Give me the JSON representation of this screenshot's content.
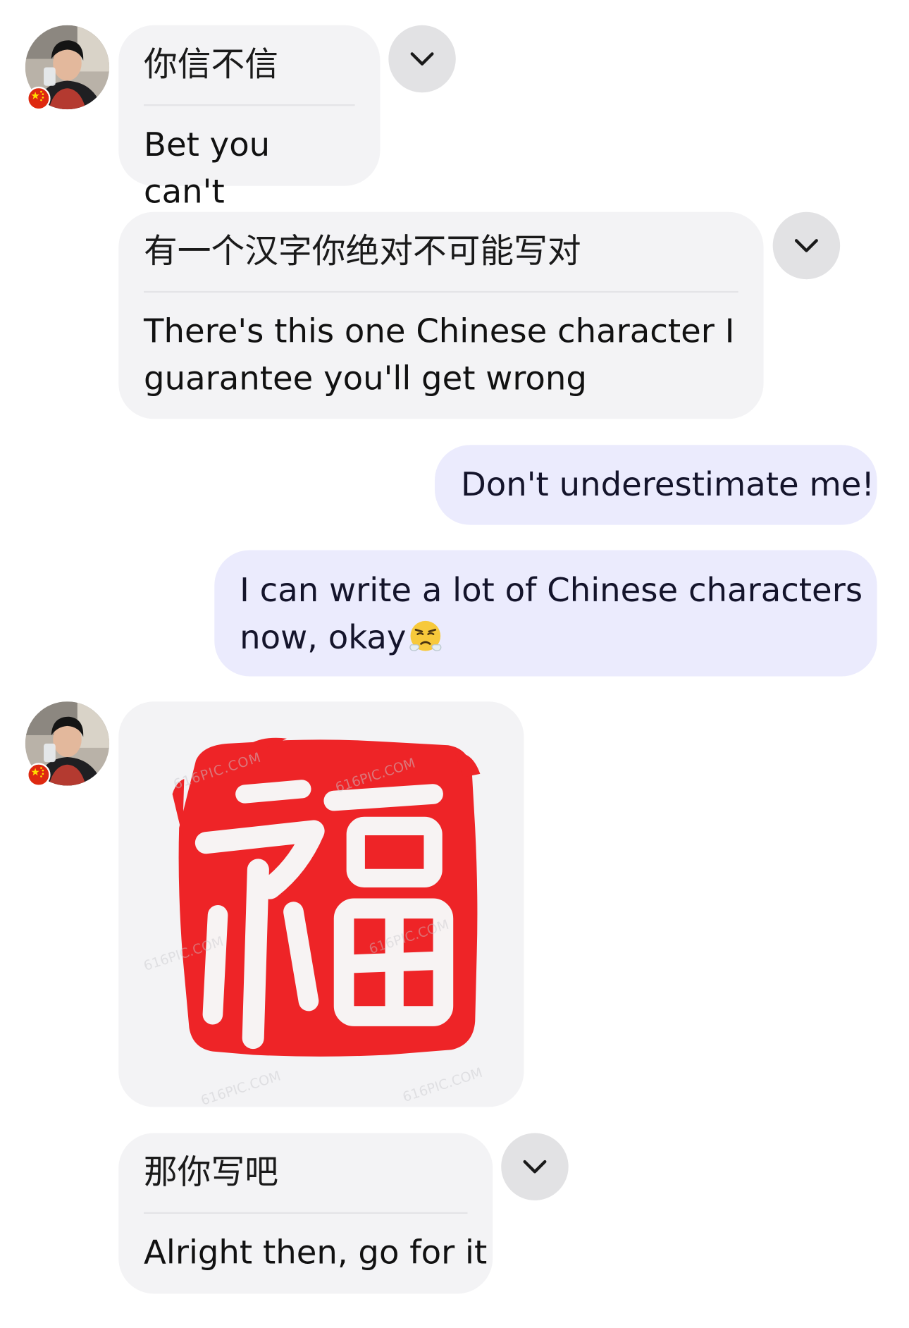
{
  "messages": [
    {
      "sender": "contact",
      "original": "你信不信",
      "translation": "Bet you can't"
    },
    {
      "sender": "contact",
      "original": "有一个汉字你绝对不可能写对",
      "translation_lines": [
        "There's this one Chinese character I",
        "guarantee you'll get wrong"
      ]
    },
    {
      "sender": "me",
      "text": "Don't underestimate me!"
    },
    {
      "sender": "me",
      "text_lines": [
        "I can write a lot of Chinese characters",
        "now, okay"
      ],
      "emoji": "face-with-steam-from-nose"
    },
    {
      "sender": "contact",
      "image_character": "福",
      "watermark": "616PIC.COM"
    },
    {
      "sender": "contact",
      "original": "那你写吧",
      "translation": "Alright then, go for it"
    }
  ],
  "icons": {
    "expand": "chevron-down-icon",
    "flag": "china-flag-icon"
  },
  "colors": {
    "incoming_bubble": "#f3f3f5",
    "outgoing_bubble": "#ebebfd",
    "seal_red": "#ee2427",
    "chevron_button": "#e2e2e4"
  }
}
